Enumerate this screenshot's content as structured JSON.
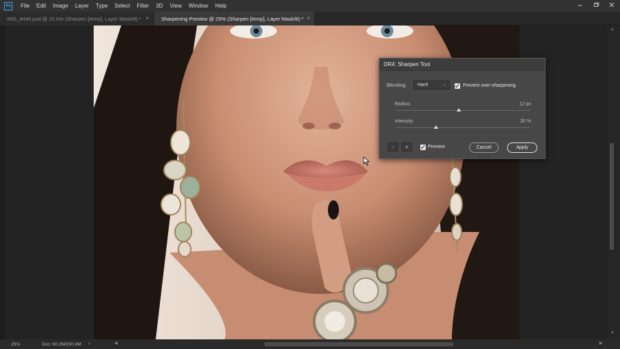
{
  "app": {
    "logo": "Ps"
  },
  "menu": {
    "items": [
      "File",
      "Edit",
      "Image",
      "Layer",
      "Type",
      "Select",
      "Filter",
      "3D",
      "View",
      "Window",
      "Help"
    ]
  },
  "tabs": [
    {
      "label": "IMG_8446.psd @ 15.6% (Sharpen [temp], Layer Mask/8) *",
      "close": "×",
      "active": false
    },
    {
      "label": "Sharpening Preview @ 25% (Sharpen [temp], Layer Mask/8) *",
      "close": "×",
      "active": true
    }
  ],
  "status": {
    "zoom": "25%",
    "doc": "Doc: 60.2M/200.8M",
    "arrow": ">"
  },
  "dialog": {
    "title": "DR4: Sharpen Tool",
    "blending_label": "Blending:",
    "blending_value": "Hard",
    "prevent_label": "Prevent over-sharpening",
    "prevent_checked": true,
    "radius_label": "Radius:",
    "radius_value": "12 px",
    "radius_level": 0.47,
    "intensity_label": "Intensity:",
    "intensity_value": "30 %",
    "intensity_level": 0.3,
    "minus_label": "-",
    "plus_label": "+",
    "preview_label": "Preview",
    "preview_checked": true,
    "cancel_label": "Cancel",
    "apply_label": "Apply"
  },
  "colors": {
    "accent": "#31a8ff",
    "panel": "#474747",
    "chrome": "#323232"
  },
  "icons": [
    "photoshop-logo-icon",
    "minimize-icon",
    "restore-icon",
    "close-icon",
    "dropdown-caret-icon",
    "checkbox-icon",
    "mouse-cursor-icon"
  ]
}
